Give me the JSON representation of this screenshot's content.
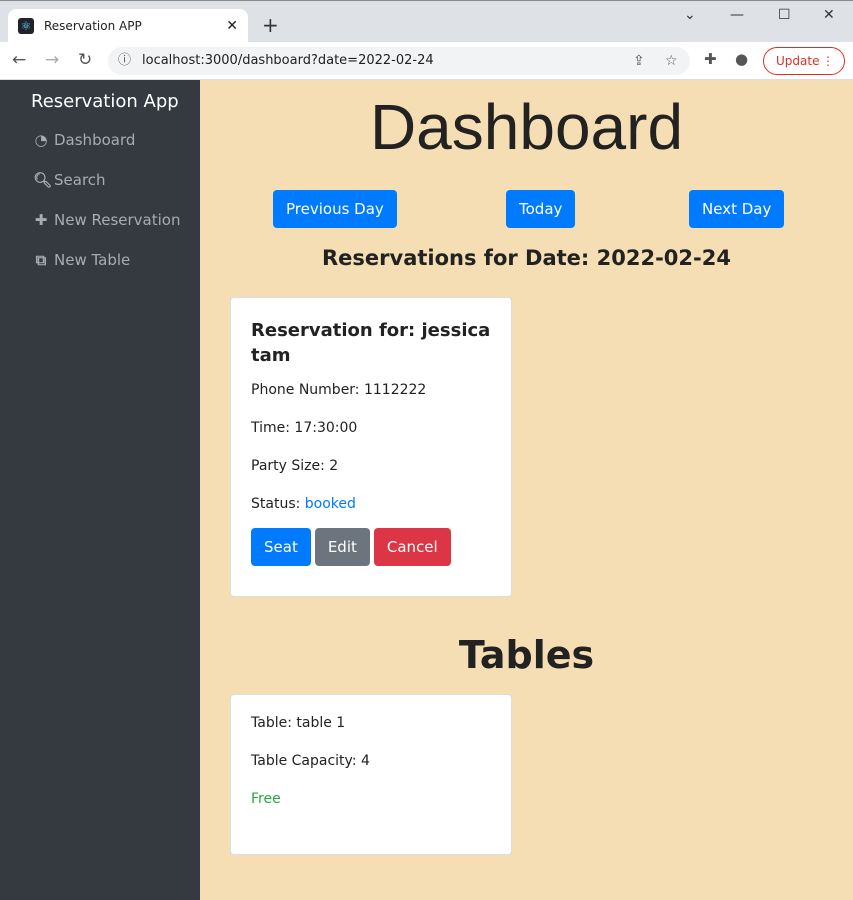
{
  "browser": {
    "tab_title": "Reservation APP",
    "url": "localhost:3000/dashboard?date=2022-02-24",
    "update_label": "Update"
  },
  "sidebar": {
    "brand": "Reservation App",
    "items": [
      {
        "label": "Dashboard",
        "icon": "dashboard-icon"
      },
      {
        "label": "Search",
        "icon": "search-icon"
      },
      {
        "label": "New Reservation",
        "icon": "plus-icon"
      },
      {
        "label": "New Table",
        "icon": "table-icon"
      }
    ]
  },
  "main": {
    "title": "Dashboard",
    "prev_label": "Previous Day",
    "today_label": "Today",
    "next_label": "Next Day",
    "reservations_heading": "Reservations for Date: 2022-02-24",
    "reservation": {
      "title": "Reservation for: jessica tam",
      "phone": "Phone Number: 1112222",
      "time": "Time: 17:30:00",
      "party": "Party Size: 2",
      "status_label": "Status: ",
      "status": "booked",
      "seat_label": "Seat",
      "edit_label": "Edit",
      "cancel_label": "Cancel"
    },
    "tables_heading": "Tables",
    "table": {
      "name": "Table: table 1",
      "capacity": "Table Capacity: 4",
      "status": "Free"
    }
  },
  "colors": {
    "primary": "#007bff",
    "secondary": "#6c757d",
    "danger": "#dc3545",
    "success": "#28a745",
    "sidebar": "#343a40",
    "background": "#f5deb3"
  }
}
